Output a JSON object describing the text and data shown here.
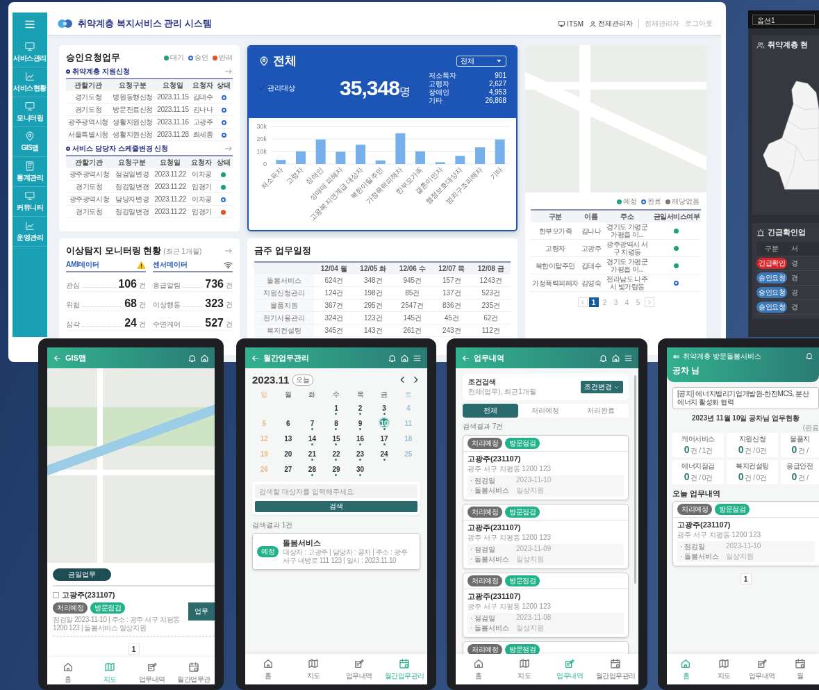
{
  "desktop": {
    "sidebar": {
      "items": [
        {
          "label": "서비스관리"
        },
        {
          "label": "서비스현황"
        },
        {
          "label": "모니터링"
        },
        {
          "label": "GIS맵"
        },
        {
          "label": "통계관리"
        },
        {
          "label": "커뮤니티"
        },
        {
          "label": "운영관리"
        }
      ]
    },
    "header": {
      "title": "취약계층 복지서비스 관리 시스템",
      "links": [
        {
          "label": "ITSM",
          "kind": "tool"
        },
        {
          "label": "전체관리자",
          "kind": "account"
        },
        {
          "label": "전체관리자",
          "kind": "muted"
        },
        {
          "label": "로그아웃",
          "kind": "muted"
        }
      ]
    },
    "approval": {
      "title": "승인요청업무",
      "legend": [
        {
          "label": "대기",
          "kind": "waiting",
          "color": "#1aa37a"
        },
        {
          "label": "승인",
          "kind": "approved",
          "color": "#2a6ad0"
        },
        {
          "label": "반려",
          "kind": "rejected",
          "color": "#e0522a"
        }
      ],
      "sections": [
        {
          "title": "취약계층 지원신청",
          "columns": [
            "관할기관",
            "요청구분",
            "요청일",
            "요청자",
            "상태"
          ],
          "rows": [
            {
              "cells": [
                "경기도청",
                "병원동행신청",
                "2023.11.15",
                "김태수"
              ],
              "kind": "approved"
            },
            {
              "cells": [
                "경기도청",
                "방문진료신청",
                "2023.11.15",
                "김나나"
              ],
              "kind": "approved"
            },
            {
              "cells": [
                "광주광역시청",
                "생활지원신청",
                "2023.11.16",
                "고광주"
              ],
              "kind": "approved"
            },
            {
              "cells": [
                "서울특별시청",
                "생활지원신청",
                "2023.11.28",
                "최세종"
              ],
              "kind": "approved"
            }
          ]
        },
        {
          "title": "서비스 담당자 스케줄변경 신청",
          "columns": [
            "관할기관",
            "요청구분",
            "요청일",
            "요청자",
            "상태"
          ],
          "rows": [
            {
              "cells": [
                "광주광역시청",
                "점검일변경",
                "2023.11.22",
                "이차공"
              ],
              "kind": "waiting"
            },
            {
              "cells": [
                "경기도청",
                "점검일변경",
                "2023.11.22",
                "임경기"
              ],
              "kind": "waiting"
            },
            {
              "cells": [
                "광주광역시청",
                "담당자변경",
                "2023.11.22",
                "이차공"
              ],
              "kind": "approved"
            },
            {
              "cells": [
                "경기도청",
                "점검일변경",
                "2023.11.22",
                "임경기"
              ],
              "kind": "rejected"
            }
          ]
        }
      ]
    },
    "monitoring": {
      "title": "이상탐지 모니터링 현황",
      "subtitle": "(최근 1개월)",
      "groups": [
        {
          "title": "AMI데이터",
          "kind": "warning",
          "items": [
            {
              "label": "관심",
              "value": "106",
              "unit": "건"
            },
            {
              "label": "위험",
              "value": "68",
              "unit": "건"
            },
            {
              "label": "심각",
              "value": "24",
              "unit": "건"
            }
          ]
        },
        {
          "title": "센서데이터",
          "kind": "wireless",
          "items": [
            {
              "label": "응급알림",
              "value": "736",
              "unit": "건"
            },
            {
              "label": "이상행동",
              "value": "323",
              "unit": "건"
            },
            {
              "label": "수면케어",
              "value": "527",
              "unit": "건"
            }
          ]
        }
      ]
    },
    "summary": {
      "title": "전체",
      "select": "전체",
      "target_label": "관리대상",
      "total": "35,348",
      "total_unit": "명",
      "breakdown": [
        {
          "label": "저소득자",
          "value": "901"
        },
        {
          "label": "고령자",
          "value": "2,627"
        },
        {
          "label": "장애인",
          "value": "4,953"
        },
        {
          "label": "기타",
          "value": "26,868"
        }
      ],
      "chart_data": {
        "type": "bar",
        "categories": [
          "저소득자",
          "고령자",
          "장애인",
          "성매매 피해자",
          "고용복지연계급 대상자",
          "북한이탈주민",
          "가정폭력피해자",
          "한부모가족",
          "결혼이민자",
          "행정보호대상자",
          "범죄구조피해자",
          "기타"
        ],
        "values": [
          3200,
          10100,
          19600,
          9800,
          15400,
          2800,
          24600,
          10100,
          1400,
          6500,
          13300,
          19600
        ],
        "ylim": [
          0,
          30000
        ],
        "yticks": [
          {
            "value": 0,
            "label": "0"
          },
          {
            "value": 10000,
            "label": "10k"
          },
          {
            "value": 20000,
            "label": "20k"
          },
          {
            "value": 30000,
            "label": "30k"
          }
        ]
      }
    },
    "weekly": {
      "title": "금주 업무일정",
      "columns": [
        "12/04 월",
        "12/05 화",
        "12/06 수",
        "12/07 목",
        "12/08 금"
      ],
      "rows": [
        {
          "label": "돌봄서비스",
          "cells": [
            "624건",
            "348건",
            "945건",
            "157건",
            "1243건"
          ]
        },
        {
          "label": "지원신청관리",
          "cells": [
            "124건",
            "198건",
            "85건",
            "137건",
            "523건"
          ]
        },
        {
          "label": "물품지원",
          "cells": [
            "367건",
            "295건",
            "2547건",
            "836건",
            "235건"
          ]
        },
        {
          "label": "전기사용관리",
          "cells": [
            "324건",
            "123건",
            "145건",
            "45건",
            "62건"
          ]
        },
        {
          "label": "복지컨설팅",
          "cells": [
            "345건",
            "143건",
            "261건",
            "243건",
            "112건"
          ]
        }
      ]
    },
    "map_panel": {
      "legend": [
        {
          "label": "예정",
          "kind": "planned",
          "color": "#1aa37a"
        },
        {
          "label": "완료",
          "kind": "done",
          "color": "#2a6ad0"
        },
        {
          "label": "해당없음",
          "kind": "none",
          "color": "#777777"
        }
      ],
      "columns": [
        "구분",
        "이름",
        "주소",
        "금일서비스여부"
      ],
      "rows": [
        {
          "cells": [
            "한부모가족",
            "김나나",
            "경기도 가평군 가평읍 이..."
          ],
          "kind": "planned"
        },
        {
          "cells": [
            "고령자",
            "고광주",
            "광주광역시 서구 치평동"
          ],
          "kind": "planned"
        },
        {
          "cells": [
            "북한이탈주민",
            "김태수",
            "경기도 가평군 가평읍 이..."
          ],
          "kind": "planned"
        },
        {
          "cells": [
            "가정폭력피해자",
            "김영숙",
            "전라남도 나주시 빛가람동"
          ],
          "kind": "done"
        }
      ],
      "pagination": [
        {
          "label": "1",
          "selected": true
        },
        {
          "label": "2",
          "selected": false
        },
        {
          "label": "3",
          "selected": false
        },
        {
          "label": "4",
          "selected": false
        },
        {
          "label": "5",
          "selected": false
        }
      ]
    }
  },
  "dark_panel": {
    "select": "옵션1",
    "map_title": "취약계층 현",
    "table_title": "긴급확인업",
    "columns": [
      "구분",
      "서"
    ],
    "rows": [
      {
        "badge": "긴급확인",
        "kind": "urgent",
        "cell": "경"
      },
      {
        "badge": "승인요청",
        "kind": "request",
        "cell": "경"
      },
      {
        "badge": "승인요청",
        "kind": "request",
        "cell": "경"
      },
      {
        "badge": "승인요청",
        "kind": "request",
        "cell": "경"
      }
    ]
  },
  "gis_app": {
    "title": "GIS맵",
    "filter": "금일업무",
    "items": [
      {
        "checked": false,
        "name": "고광주(231107)",
        "badges": [
          {
            "label": "처리예정",
            "kind": "status"
          },
          {
            "label": "방문점검",
            "kind": "type"
          }
        ],
        "detail": "점검일 2023-11-10 | 주소 : 광주 서구 치평동 1200 123 | 돌봄서비스 일상지원",
        "action": "업무"
      }
    ],
    "pagination": [
      {
        "label": "1",
        "selected": true
      }
    ],
    "tabbar": [
      {
        "label": "홈",
        "selected": false
      },
      {
        "label": "지도",
        "selected": true
      },
      {
        "label": "업무내역",
        "selected": false
      },
      {
        "label": "월간업무관",
        "selected": false
      }
    ]
  },
  "calendar_app": {
    "title": "월간업무관리",
    "month": "2023.11",
    "today": "오늘",
    "weekdays": [
      "일",
      "월",
      "화",
      "수",
      "목",
      "금",
      "토"
    ],
    "days": [
      {
        "kind": "blank"
      },
      {
        "kind": "blank"
      },
      {
        "kind": "blank"
      },
      {
        "kind": "day",
        "label": "1",
        "has_event": true,
        "selected": false
      },
      {
        "kind": "day",
        "label": "2",
        "has_event": true,
        "selected": false
      },
      {
        "kind": "day",
        "label": "3",
        "has_event": true,
        "selected": false
      },
      {
        "kind": "day",
        "label": "4",
        "has_event": false,
        "selected": false
      },
      {
        "kind": "day",
        "label": "5",
        "has_event": false,
        "selected": false
      },
      {
        "kind": "day",
        "label": "6",
        "has_event": false,
        "selected": false
      },
      {
        "kind": "day",
        "label": "7",
        "has_event": true,
        "selected": false
      },
      {
        "kind": "day",
        "label": "8",
        "has_event": true,
        "selected": false
      },
      {
        "kind": "day",
        "label": "9",
        "has_event": true,
        "selected": false
      },
      {
        "kind": "day",
        "label": "10",
        "has_event": true,
        "selected": true
      },
      {
        "kind": "day",
        "label": "11",
        "has_event": false,
        "selected": false
      },
      {
        "kind": "day",
        "label": "12",
        "has_event": false,
        "selected": false
      },
      {
        "kind": "day",
        "label": "13",
        "has_event": false,
        "selected": false
      },
      {
        "kind": "day",
        "label": "14",
        "has_event": true,
        "selected": false
      },
      {
        "kind": "day",
        "label": "15",
        "has_event": true,
        "selected": false
      },
      {
        "kind": "day",
        "label": "16",
        "has_event": true,
        "selected": false
      },
      {
        "kind": "day",
        "label": "17",
        "has_event": true,
        "selected": false
      },
      {
        "kind": "day",
        "label": "18",
        "has_event": false,
        "selected": false
      },
      {
        "kind": "day",
        "label": "19",
        "has_event": false,
        "selected": false
      },
      {
        "kind": "day",
        "label": "20",
        "has_event": false,
        "selected": false
      },
      {
        "kind": "day",
        "label": "21",
        "has_event": true,
        "selected": false
      },
      {
        "kind": "day",
        "label": "22",
        "has_event": true,
        "selected": false
      },
      {
        "kind": "day",
        "label": "23",
        "has_event": true,
        "selected": false
      },
      {
        "kind": "day",
        "label": "24",
        "has_event": true,
        "selected": false
      },
      {
        "kind": "day",
        "label": "25",
        "has_event": false,
        "selected": false
      },
      {
        "kind": "day",
        "label": "26",
        "has_event": false,
        "selected": false
      },
      {
        "kind": "day",
        "label": "27",
        "has_event": false,
        "selected": false
      },
      {
        "kind": "day",
        "label": "28",
        "has_event": true,
        "selected": false
      },
      {
        "kind": "day",
        "label": "29",
        "has_event": true,
        "selected": false
      },
      {
        "kind": "day",
        "label": "30",
        "has_event": true,
        "selected": false
      }
    ],
    "search": {
      "placeholder": "검색할 대상자를 입력해주세요.",
      "button": "검색"
    },
    "result_count": "검색결과 1건",
    "results": [
      {
        "badge": "예정",
        "title": "돌봄서비스",
        "detail": "대상자 : 고광주 | 담당자 : 공차 | 주소 : 광주 서구 내방로 111 123 | 일시 : 2023.11.10"
      }
    ],
    "tabbar": [
      {
        "label": "홈",
        "selected": false
      },
      {
        "label": "지도",
        "selected": false
      },
      {
        "label": "업무내역",
        "selected": false
      },
      {
        "label": "월간업무관리",
        "selected": true
      }
    ]
  },
  "history_app": {
    "title": "업무내역",
    "filter": {
      "title": "조건검색",
      "summary": "전체(업무), 최근1개월",
      "button": "조건변경"
    },
    "tabs": [
      {
        "label": "전체",
        "selected": true
      },
      {
        "label": "처리예정",
        "selected": false
      },
      {
        "label": "처리완료",
        "selected": false
      }
    ],
    "result_count": "검색결과 7건",
    "cards": [
      {
        "badges": [
          {
            "label": "처리예정",
            "kind": "status"
          },
          {
            "label": "방문점검",
            "kind": "type"
          }
        ],
        "name": "고광주(231107)",
        "address": "광주 서구 치평동 1200 123",
        "details": [
          {
            "label": "· 점검일",
            "value": "2023-11-10"
          },
          {
            "label": "· 돌봄서비스",
            "value": "일상지원"
          }
        ]
      },
      {
        "badges": [
          {
            "label": "처리예정",
            "kind": "status"
          },
          {
            "label": "방문점검",
            "kind": "type"
          }
        ],
        "name": "고광주(231107)",
        "address": "광주 서구 치평동 1200 123",
        "details": [
          {
            "label": "· 점검일",
            "value": "2023-11-09"
          },
          {
            "label": "· 돌봄서비스",
            "value": "일상지원"
          }
        ]
      },
      {
        "badges": [
          {
            "label": "처리예정",
            "kind": "status"
          },
          {
            "label": "방문점검",
            "kind": "type"
          }
        ],
        "name": "고광주(231107)",
        "address": "광주 서구 치평동 1200 123",
        "details": [
          {
            "label": "· 점검일",
            "value": "2023-11-08"
          },
          {
            "label": "· 돌봄서비스",
            "value": "일상지원"
          }
        ]
      },
      {
        "badges": [
          {
            "label": "처리예정",
            "kind": "status"
          },
          {
            "label": "방문점검",
            "kind": "type"
          }
        ]
      }
    ],
    "tabbar": [
      {
        "label": "홈",
        "selected": false
      },
      {
        "label": "지도",
        "selected": false
      },
      {
        "label": "업무내역",
        "selected": true
      },
      {
        "label": "월간업무관리",
        "selected": false
      }
    ]
  },
  "home_app": {
    "service_name": "취약계층 방문돌봄서비스",
    "greeting": "공차 님",
    "notice": "[공지] 에너지밸리기업개발원-한전MCS, 분산에너지 활성화 협력",
    "status_title": "2023년 11월 10일 공차님 업무현황",
    "status_note": "(완료",
    "stats": [
      {
        "label": "케어서비스",
        "value": "0",
        "unit": "건 / 1건"
      },
      {
        "label": "지원신청",
        "value": "0",
        "unit": "건 / 0건"
      },
      {
        "label": "물품지",
        "value": "0",
        "unit": "건 /"
      },
      {
        "label": "에너지점검",
        "value": "0",
        "unit": "건 / 0건"
      },
      {
        "label": "복지컨설팅",
        "value": "0",
        "unit": "건 / 0건"
      },
      {
        "label": "응급안전",
        "value": "0",
        "unit": "건 /"
      }
    ],
    "today_title": "오늘 업무내역",
    "cards": [
      {
        "badges": [
          {
            "label": "처리예정",
            "kind": "status"
          },
          {
            "label": "방문점검",
            "kind": "type"
          }
        ],
        "name": "고광주(231107)",
        "address": "광주 서구 치평동 1200 123",
        "details": [
          {
            "label": "· 점검일",
            "value": "2023-11-10"
          },
          {
            "label": "· 돌봄서비스",
            "value": "일상지원"
          }
        ]
      }
    ],
    "pagination": [
      {
        "label": "1",
        "selected": true
      }
    ],
    "tabbar": [
      {
        "label": "홈",
        "selected": true
      },
      {
        "label": "지도",
        "selected": false
      },
      {
        "label": "업무내역",
        "selected": false
      },
      {
        "label": "월",
        "selected": false
      }
    ]
  }
}
